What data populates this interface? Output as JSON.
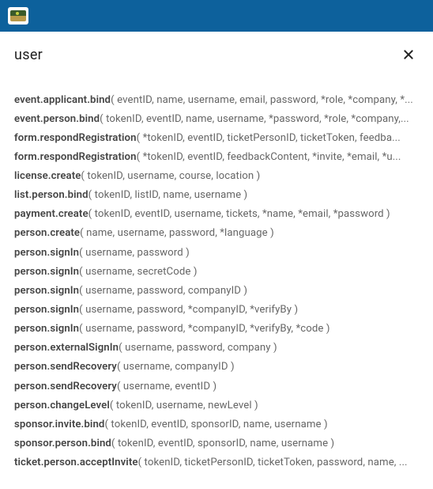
{
  "header": {
    "app_icon_name": "app-logo-icon"
  },
  "search": {
    "value": "user",
    "placeholder": "",
    "close_label": "Close"
  },
  "results": [
    {
      "method": "event.applicant.bind",
      "params": "( eventID, name, username, email, password, *role, *company, *..."
    },
    {
      "method": "event.person.bind",
      "params": "( tokenID, eventID, name, username, *password, *role, *company,..."
    },
    {
      "method": "form.respondRegistration",
      "params": "( *tokenID, eventID, ticketPersonID, ticketToken, feedba..."
    },
    {
      "method": "form.respondRegistration",
      "params": "( *tokenID, eventID, feedbackContent, *invite, *email, *u..."
    },
    {
      "method": "license.create",
      "params": "( tokenID, username, course, location )"
    },
    {
      "method": "list.person.bind",
      "params": "( tokenID, listID, name, username )"
    },
    {
      "method": "payment.create",
      "params": "( tokenID, eventID, username, tickets, *name, *email, *password )"
    },
    {
      "method": "person.create",
      "params": "( name, username, password, *language )"
    },
    {
      "method": "person.signIn",
      "params": "( username, password )"
    },
    {
      "method": "person.signIn",
      "params": "( username, secretCode )"
    },
    {
      "method": "person.signIn",
      "params": "( username, password, companyID )"
    },
    {
      "method": "person.signIn",
      "params": "( username, password, *companyID, *verifyBy )"
    },
    {
      "method": "person.signIn",
      "params": "( username, password, *companyID, *verifyBy, *code )"
    },
    {
      "method": "person.externalSignIn",
      "params": "( username, password, company )"
    },
    {
      "method": "person.sendRecovery",
      "params": "( username, companyID )"
    },
    {
      "method": "person.sendRecovery",
      "params": "( username, eventID )"
    },
    {
      "method": "person.changeLevel",
      "params": "( tokenID, username, newLevel )"
    },
    {
      "method": "sponsor.invite.bind",
      "params": "( tokenID, eventID, sponsorID, name, username )"
    },
    {
      "method": "sponsor.person.bind",
      "params": "( tokenID, eventID, sponsorID, name, username )"
    },
    {
      "method": "ticket.person.acceptInvite",
      "params": "( tokenID, ticketPersonID, ticketToken, password, name, ..."
    }
  ]
}
